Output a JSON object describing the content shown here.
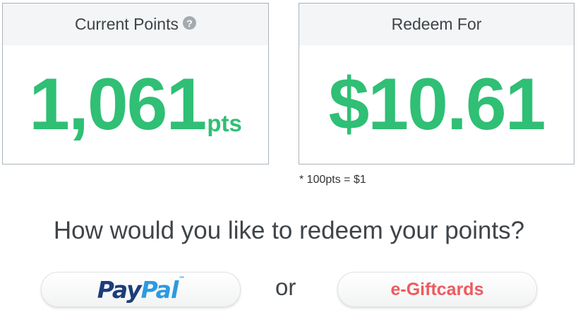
{
  "points_card": {
    "title": "Current Points",
    "help_icon": "?",
    "value": "1,061",
    "unit": "pts"
  },
  "redeem_card": {
    "title": "Redeem For",
    "value": "$10.61"
  },
  "footnote": "* 100pts = $1",
  "question": "How would you like to redeem your points?",
  "options": {
    "paypal": {
      "label_part1": "Pay",
      "label_part2": "Pal",
      "trademark": "™"
    },
    "separator": "or",
    "giftcards": {
      "label": "e-Giftcards"
    }
  },
  "colors": {
    "accent_green": "#2fbf75",
    "gift_red": "#ee5a5e",
    "paypal_dark": "#1c3d7a",
    "paypal_light": "#2b9be0"
  }
}
